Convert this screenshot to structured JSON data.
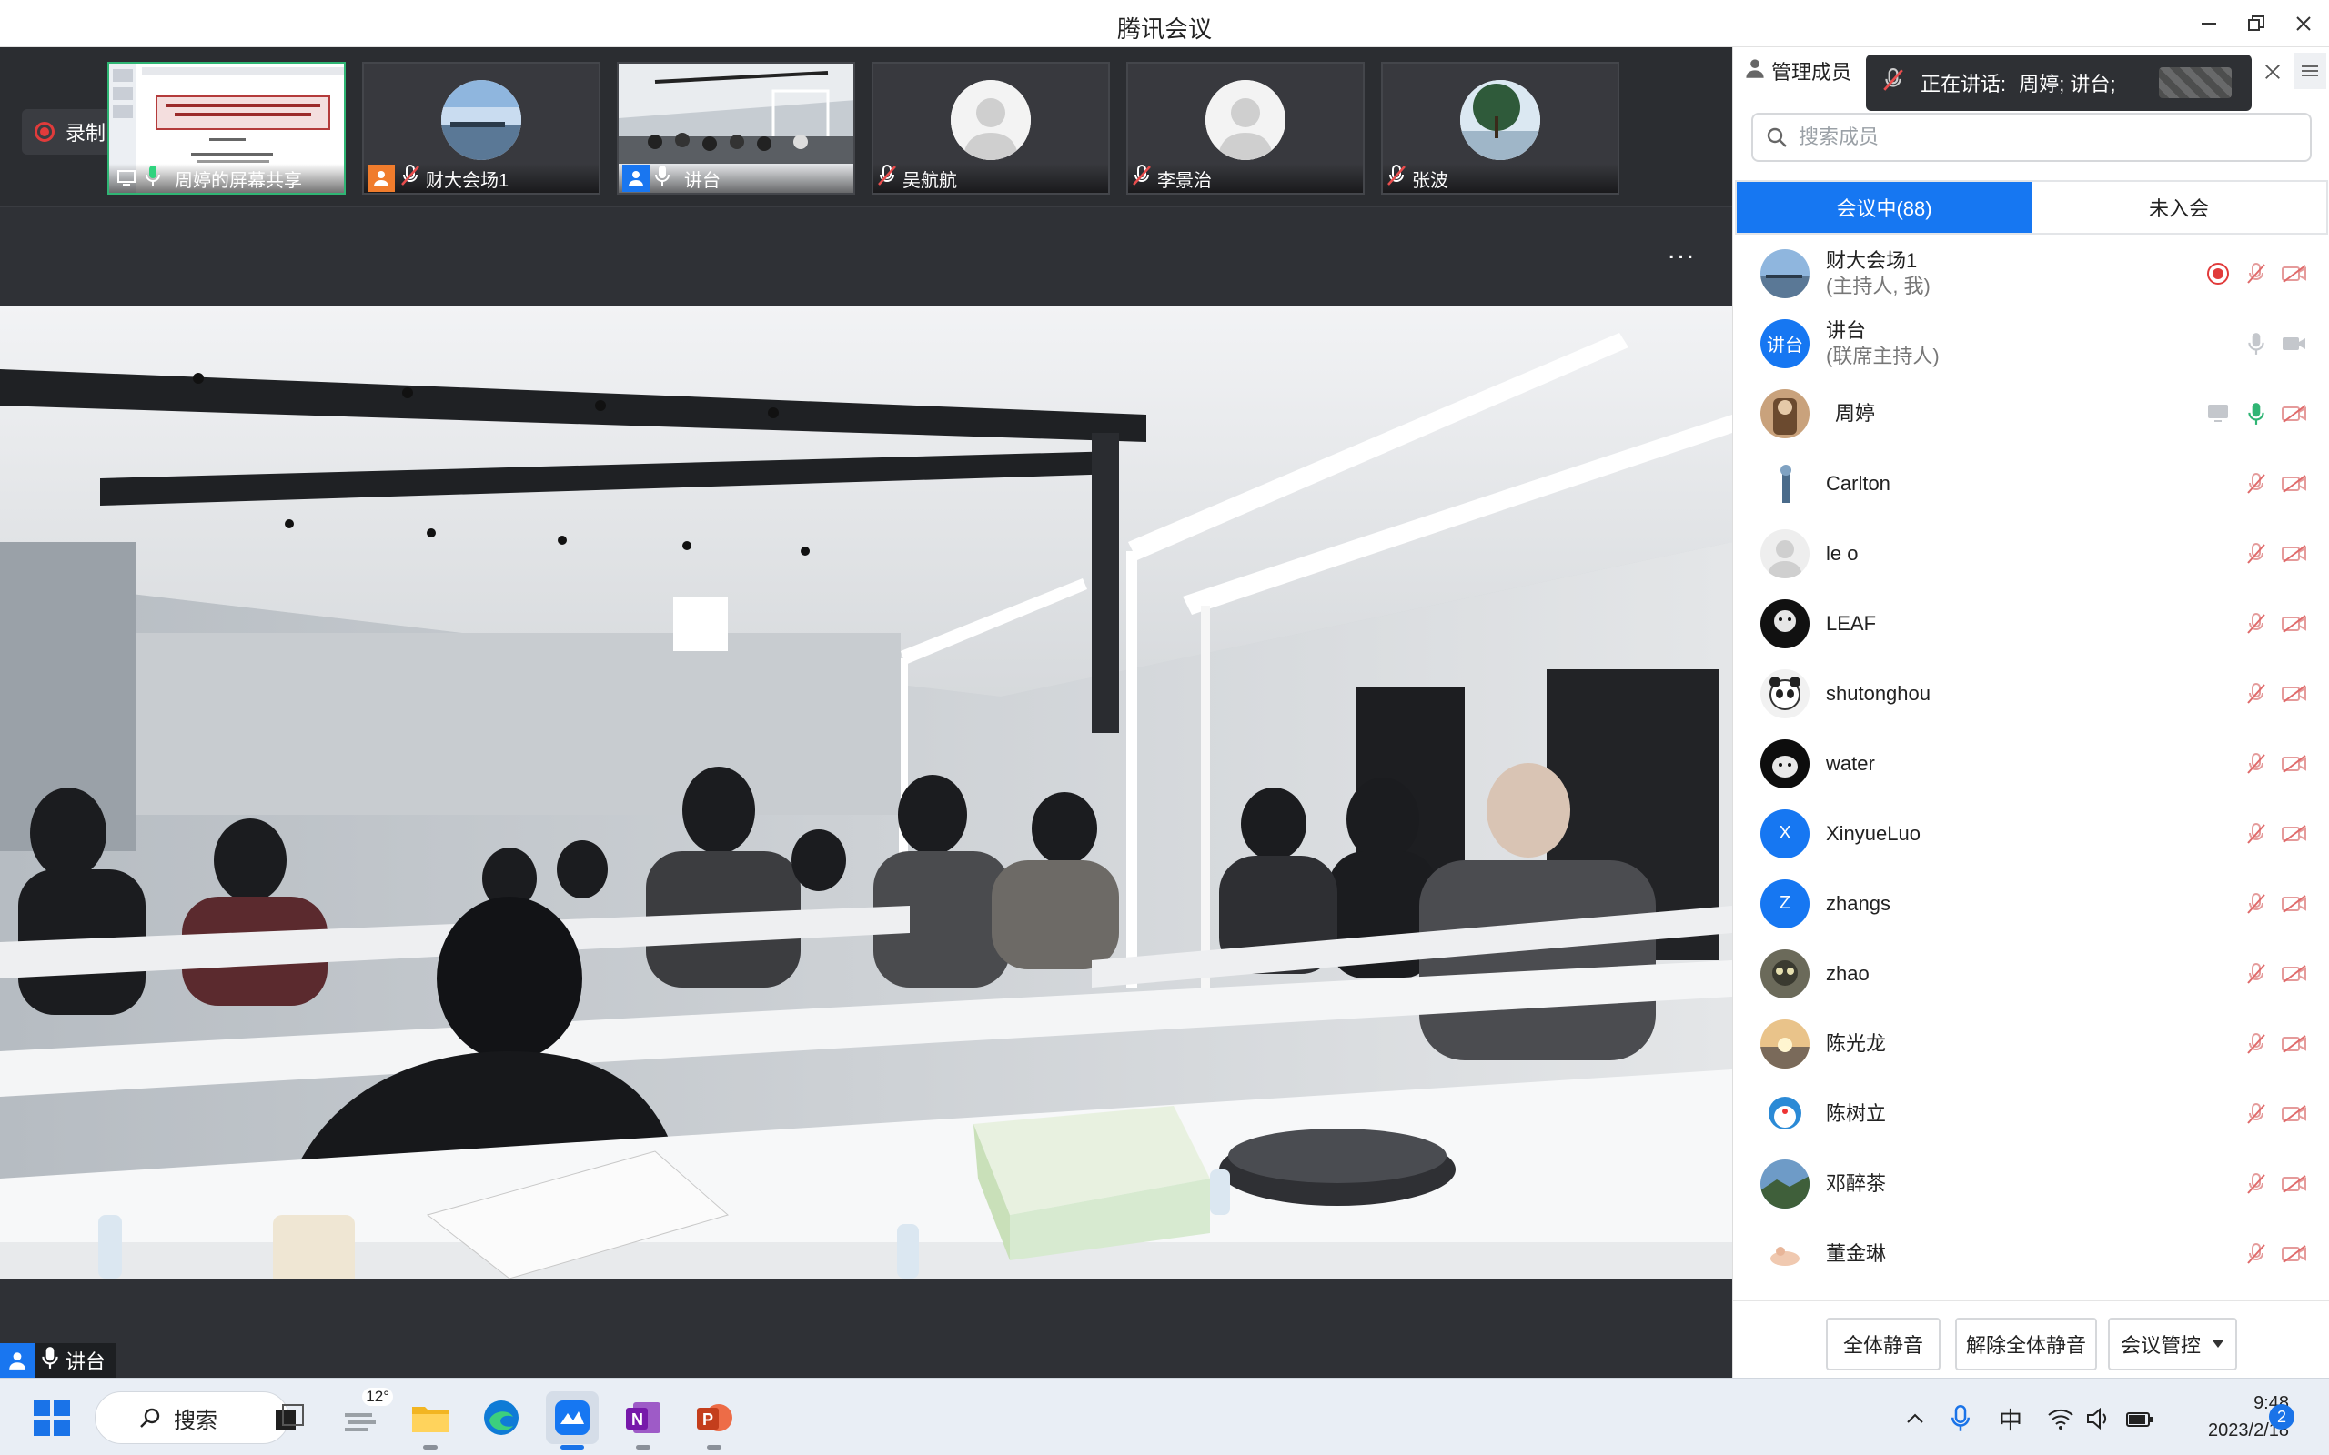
{
  "window": {
    "title": "腾讯会议"
  },
  "recording": {
    "label": "录制中"
  },
  "thumbnails": [
    {
      "label": "周婷的屏幕共享"
    },
    {
      "label": "财大会场1"
    },
    {
      "label": "讲台"
    },
    {
      "label": "吴航航"
    },
    {
      "label": "李景治"
    },
    {
      "label": "张波"
    }
  ],
  "stage": {
    "more": "...",
    "speaker": "讲台"
  },
  "panel": {
    "title": "管理成员",
    "speaking_prefix": "正在讲话:",
    "speaking_names": "周婷; 讲台;",
    "search_placeholder": "搜索成员",
    "tab_in_meeting": "会议中(88)",
    "tab_not_joined": "未入会",
    "members": [
      {
        "name": "财大会场1",
        "role": "(主持人, 我)"
      },
      {
        "name": "讲台",
        "role": "(联席主持人)",
        "avatar_text": "讲台"
      },
      {
        "name": "周婷"
      },
      {
        "name": "Carlton"
      },
      {
        "name": "le o"
      },
      {
        "name": "LEAF"
      },
      {
        "name": "shutonghou"
      },
      {
        "name": "water"
      },
      {
        "name": "XinyueLuo",
        "avatar_text": "X"
      },
      {
        "name": "zhangs",
        "avatar_text": "Z"
      },
      {
        "name": "zhao"
      },
      {
        "name": "陈光龙"
      },
      {
        "name": "陈树立"
      },
      {
        "name": "邓醉茶"
      },
      {
        "name": "董金琳"
      }
    ],
    "btn_mute_all": "全体静音",
    "btn_unmute_all": "解除全体静音",
    "btn_control": "会议管控"
  },
  "taskbar": {
    "search": "搜索",
    "weather": "12°",
    "ime": "中",
    "time": "9:48",
    "date": "2023/2/18",
    "notifications": "2"
  },
  "colors": {
    "accent": "#1677f2",
    "recording": "#e13b3b",
    "active_border": "#2fb574",
    "muted": "#e06a6a"
  }
}
